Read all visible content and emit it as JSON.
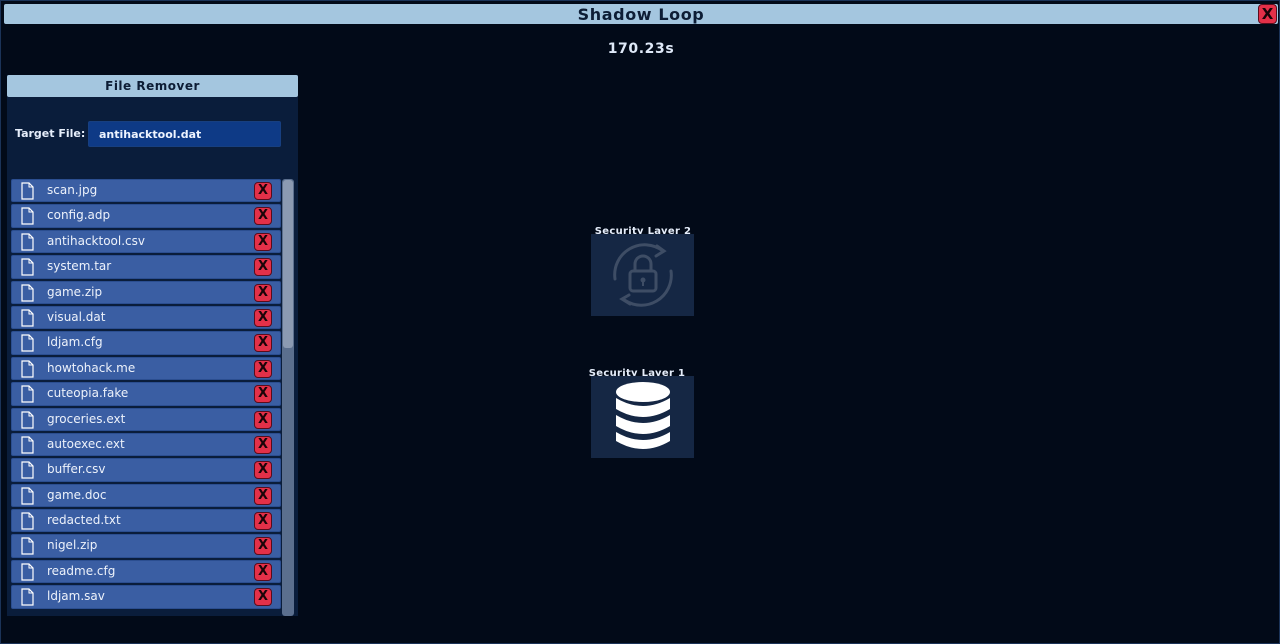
{
  "window": {
    "title": "Shadow Loop"
  },
  "timer": "170.23s",
  "file_remover": {
    "title": "File Remover",
    "target_label": "Target File:",
    "target_value": "antihacktool.dat",
    "files": [
      "scan.jpg",
      "config.adp",
      "antihacktool.csv",
      "system.tar",
      "game.zip",
      "visual.dat",
      "ldjam.cfg",
      "howtohack.me",
      "cuteopia.fake",
      "groceries.ext",
      "autoexec.ext",
      "buffer.csv",
      "game.doc",
      "redacted.txt",
      "nigel.zip",
      "readme.cfg",
      "ldjam.sav"
    ],
    "delete_glyph": "X"
  },
  "security_layers": [
    {
      "label": "Security Layer 2",
      "icon": "lock-rotate-icon",
      "state": "locked"
    },
    {
      "label": "Security Layer 1",
      "icon": "database-icon",
      "state": "active"
    }
  ],
  "colors": {
    "background": "#020a18",
    "header": "#a4c6df",
    "row": "#3a5ea3",
    "close": "#e33048"
  }
}
